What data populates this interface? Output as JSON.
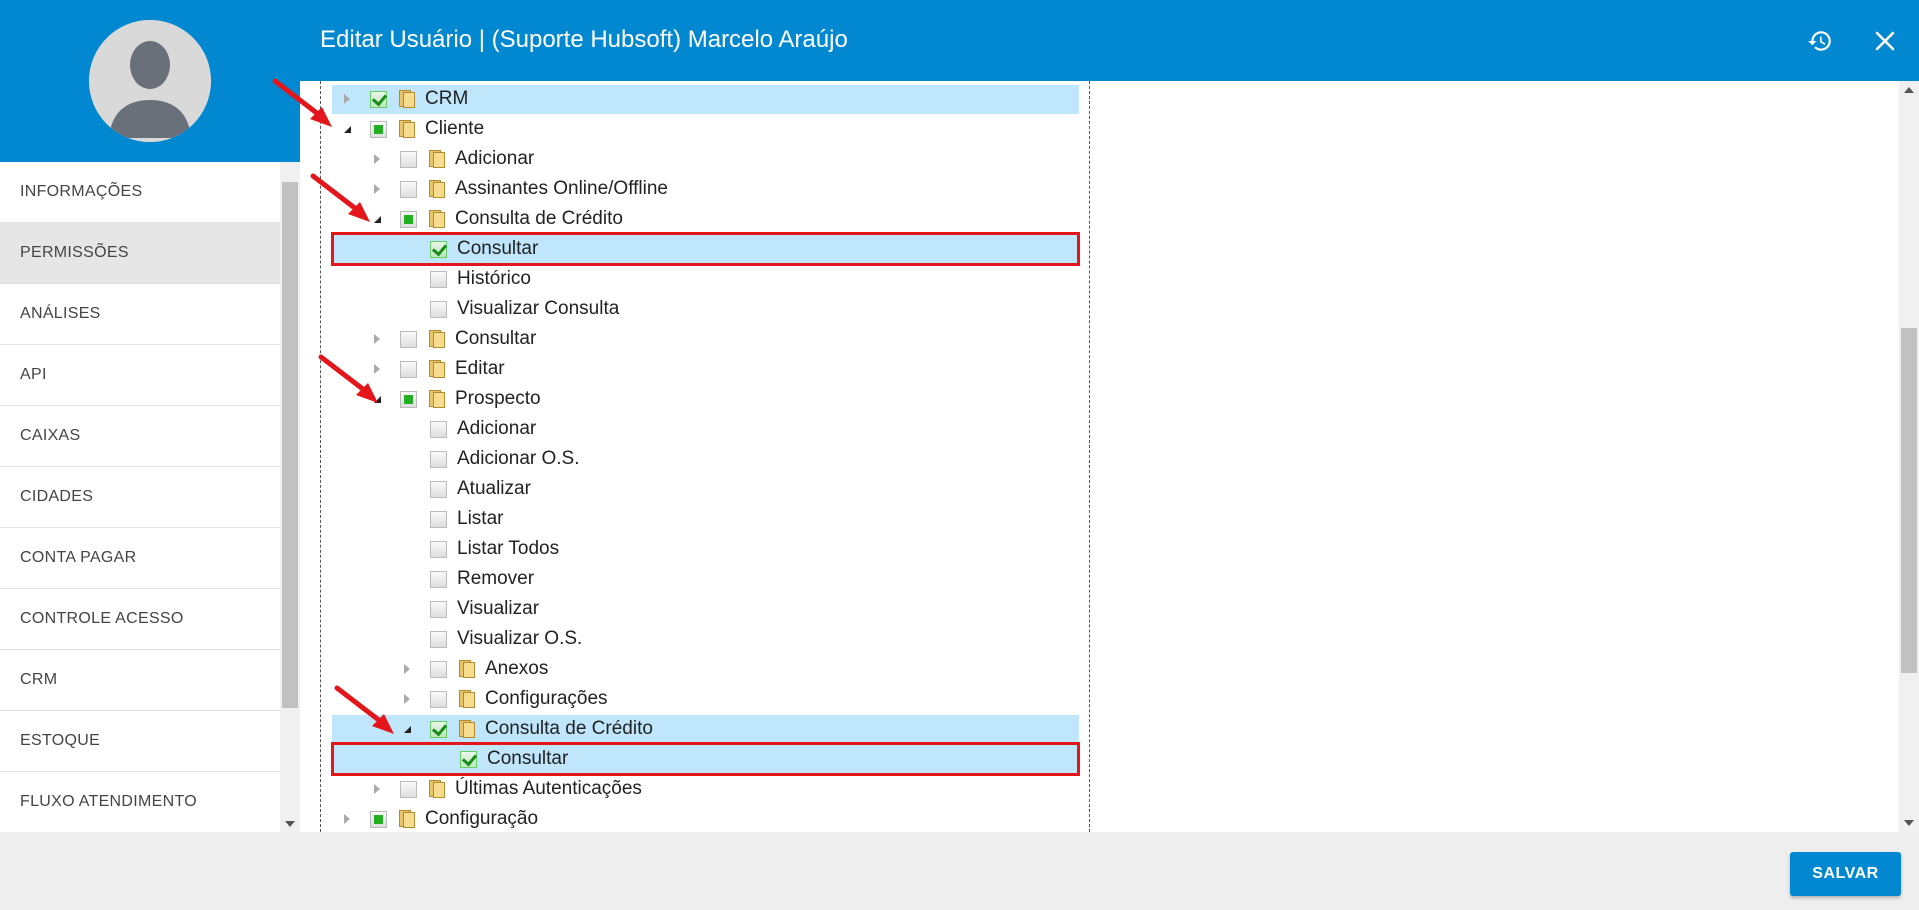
{
  "header": {
    "title": "Editar Usuário | (Suporte Hubsoft) Marcelo Araújo",
    "history_icon": "history-icon",
    "close_icon": "close-icon",
    "bg_color": "#0288d1"
  },
  "sidebar": {
    "items": [
      {
        "label": "INFORMAÇÕES",
        "active": false
      },
      {
        "label": "PERMISSÕES",
        "active": true
      },
      {
        "label": "ANÁLISES",
        "active": false
      },
      {
        "label": "API",
        "active": false
      },
      {
        "label": "CAIXAS",
        "active": false
      },
      {
        "label": "CIDADES",
        "active": false
      },
      {
        "label": "CONTA PAGAR",
        "active": false
      },
      {
        "label": "CONTROLE ACESSO",
        "active": false
      },
      {
        "label": "CRM",
        "active": false
      },
      {
        "label": "ESTOQUE",
        "active": false
      },
      {
        "label": "FLUXO ATENDIMENTO",
        "active": false
      }
    ]
  },
  "tree": [
    {
      "label": "CRM",
      "level": 0,
      "expander": "collapsed",
      "check": "checked",
      "folder": true,
      "highlight": "bg"
    },
    {
      "label": "Cliente",
      "level": 0,
      "expander": "open",
      "check": "partial",
      "folder": true
    },
    {
      "label": "Adicionar",
      "level": 1,
      "expander": "collapsed",
      "check": "none",
      "folder": true
    },
    {
      "label": "Assinantes Online/Offline",
      "level": 1,
      "expander": "collapsed",
      "check": "none",
      "folder": true
    },
    {
      "label": "Consulta de Crédito",
      "level": 1,
      "expander": "open",
      "check": "partial",
      "folder": true
    },
    {
      "label": "Consultar",
      "level": 2,
      "expander": "none",
      "check": "checked",
      "folder": false,
      "highlight": "box"
    },
    {
      "label": "Histórico",
      "level": 2,
      "expander": "none",
      "check": "none",
      "folder": false
    },
    {
      "label": "Visualizar Consulta",
      "level": 2,
      "expander": "none",
      "check": "none",
      "folder": false
    },
    {
      "label": "Consultar",
      "level": 1,
      "expander": "collapsed",
      "check": "none",
      "folder": true
    },
    {
      "label": "Editar",
      "level": 1,
      "expander": "collapsed",
      "check": "none",
      "folder": true
    },
    {
      "label": "Prospecto",
      "level": 1,
      "expander": "open",
      "check": "partial",
      "folder": true
    },
    {
      "label": "Adicionar",
      "level": 2,
      "expander": "none",
      "check": "none",
      "folder": false
    },
    {
      "label": "Adicionar O.S.",
      "level": 2,
      "expander": "none",
      "check": "none",
      "folder": false
    },
    {
      "label": "Atualizar",
      "level": 2,
      "expander": "none",
      "check": "none",
      "folder": false
    },
    {
      "label": "Listar",
      "level": 2,
      "expander": "none",
      "check": "none",
      "folder": false
    },
    {
      "label": "Listar Todos",
      "level": 2,
      "expander": "none",
      "check": "none",
      "folder": false
    },
    {
      "label": "Remover",
      "level": 2,
      "expander": "none",
      "check": "none",
      "folder": false
    },
    {
      "label": "Visualizar",
      "level": 2,
      "expander": "none",
      "check": "none",
      "folder": false
    },
    {
      "label": "Visualizar O.S.",
      "level": 2,
      "expander": "none",
      "check": "none",
      "folder": false
    },
    {
      "label": "Anexos",
      "level": 2,
      "expander": "collapsed",
      "check": "none",
      "folder": true
    },
    {
      "label": "Configurações",
      "level": 2,
      "expander": "collapsed",
      "check": "none",
      "folder": true
    },
    {
      "label": "Consulta de Crédito",
      "level": 2,
      "expander": "open",
      "check": "checked",
      "folder": true,
      "highlight": "bg"
    },
    {
      "label": "Consultar",
      "level": 3,
      "expander": "none",
      "check": "checked",
      "folder": false,
      "highlight": "box"
    },
    {
      "label": "Últimas Autenticações",
      "level": 1,
      "expander": "collapsed",
      "check": "none",
      "folder": true
    },
    {
      "label": "Configuração",
      "level": 0,
      "expander": "collapsed",
      "check": "partial",
      "folder": true
    }
  ],
  "footer": {
    "save_label": "SALVAR"
  },
  "colors": {
    "accent": "#0288d1",
    "highlight_row": "#bfe6fb",
    "annotation_red": "#e4161b"
  }
}
